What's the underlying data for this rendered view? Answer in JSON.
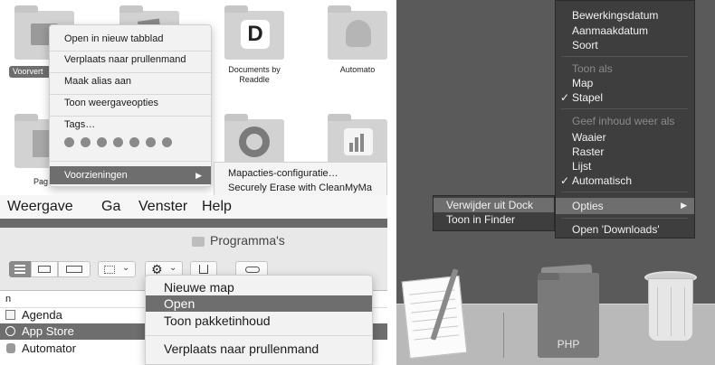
{
  "panel1": {
    "icons": [
      {
        "label": "Voorvert",
        "selected": true
      },
      {
        "label": "Documents by Readdle"
      },
      {
        "label": "Automato"
      },
      {
        "label": "Pag"
      },
      {
        "label": ""
      },
      {
        "label": ""
      }
    ],
    "doc_letter": "D",
    "context_menu": {
      "items": [
        "Open in nieuw tabblad",
        "Verplaats naar prullenmand",
        "Maak alias aan",
        "Toon weergaveopties",
        "Tags…"
      ],
      "tag_colors": [
        "#8a8a8a",
        "#8a8a8a",
        "#8a8a8a",
        "#8a8a8a",
        "#8a8a8a",
        "#8a8a8a",
        "#8a8a8a"
      ],
      "services_label": "Voorzieningen",
      "services_arrow": "▶"
    },
    "submenu": {
      "items": [
        "Mapacties-configuratie…",
        "Securely Erase with CleanMyMa"
      ]
    }
  },
  "panel2": {
    "menubar": [
      "Weergave",
      "Ga",
      "Venster",
      "Help"
    ],
    "window_title": "Programma's",
    "column_header": "n",
    "rows": [
      {
        "label": "Agenda",
        "selected": false
      },
      {
        "label": "App Store",
        "selected": true
      },
      {
        "label": "Automator",
        "selected": false
      }
    ],
    "context_menu": {
      "items": [
        "Nieuwe map",
        "Open",
        "Toon pakketinhoud",
        "Verplaats naar prullenmand"
      ],
      "highlighted": "Open"
    }
  },
  "panel3": {
    "menu": {
      "sort_items": [
        "Bewerkingsdatum",
        "Aanmaakdatum",
        "Soort"
      ],
      "view_header": "Toon als",
      "view_items": [
        "Map",
        "Stapel"
      ],
      "view_checked": "Stapel",
      "content_header": "Geef inhoud weer als",
      "content_items": [
        "Waaier",
        "Raster",
        "Lijst",
        "Automatisch"
      ],
      "content_checked": "Automatisch",
      "options_label": "Opties",
      "options_arrow": "▶",
      "open_downloads": "Open 'Downloads'",
      "checkmark": "✓"
    },
    "submenu": {
      "items": [
        "Verwijder uit Dock",
        "Toon in Finder"
      ],
      "highlighted": "Verwijder uit Dock"
    },
    "dock": {
      "stack_label": "PHP"
    }
  },
  "colors": {
    "highlight": "#6e6e6e",
    "menu_bg": "#f2f2f2",
    "dark_menu_bg": "#3e3e3e",
    "desktop": "#5a5a5a"
  }
}
